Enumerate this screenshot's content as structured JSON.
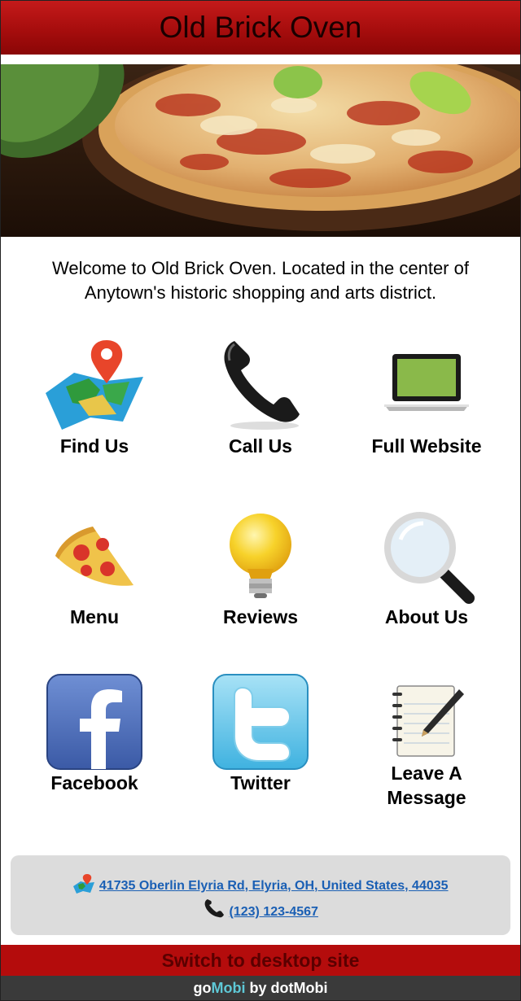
{
  "header": {
    "title": "Old Brick Oven"
  },
  "hero": {
    "icon": "pizza-photo"
  },
  "welcome": {
    "line1": "Welcome to Old Brick Oven. Located in the center of",
    "line2": "Anytown's historic shopping and arts district."
  },
  "tiles": [
    {
      "label": "Find Us",
      "icon": "map-pin-icon"
    },
    {
      "label": "Call Us",
      "icon": "phone-icon"
    },
    {
      "label": "Full Website",
      "icon": "laptop-icon"
    },
    {
      "label": "Menu",
      "icon": "pizza-slice-icon"
    },
    {
      "label": "Reviews",
      "icon": "lightbulb-icon"
    },
    {
      "label": "About Us",
      "icon": "magnifier-icon"
    },
    {
      "label": "Facebook",
      "icon": "facebook-icon"
    },
    {
      "label": "Twitter",
      "icon": "twitter-icon"
    },
    {
      "label_line1": "Leave A",
      "label_line2": "Message",
      "icon": "notepad-icon"
    }
  ],
  "contact": {
    "address": "41735 Oberlin Elyria Rd, Elyria, OH, United States, 44035",
    "phone": "(123) 123-4567"
  },
  "switch_label": "Switch to desktop site",
  "brand": {
    "part1": "go",
    "part2": "Mobi",
    "part3": " by dotMobi"
  },
  "colors": {
    "header_red": "#a60d0d",
    "link_blue": "#1a5fb4",
    "footer_gray": "#dcdcdc"
  }
}
